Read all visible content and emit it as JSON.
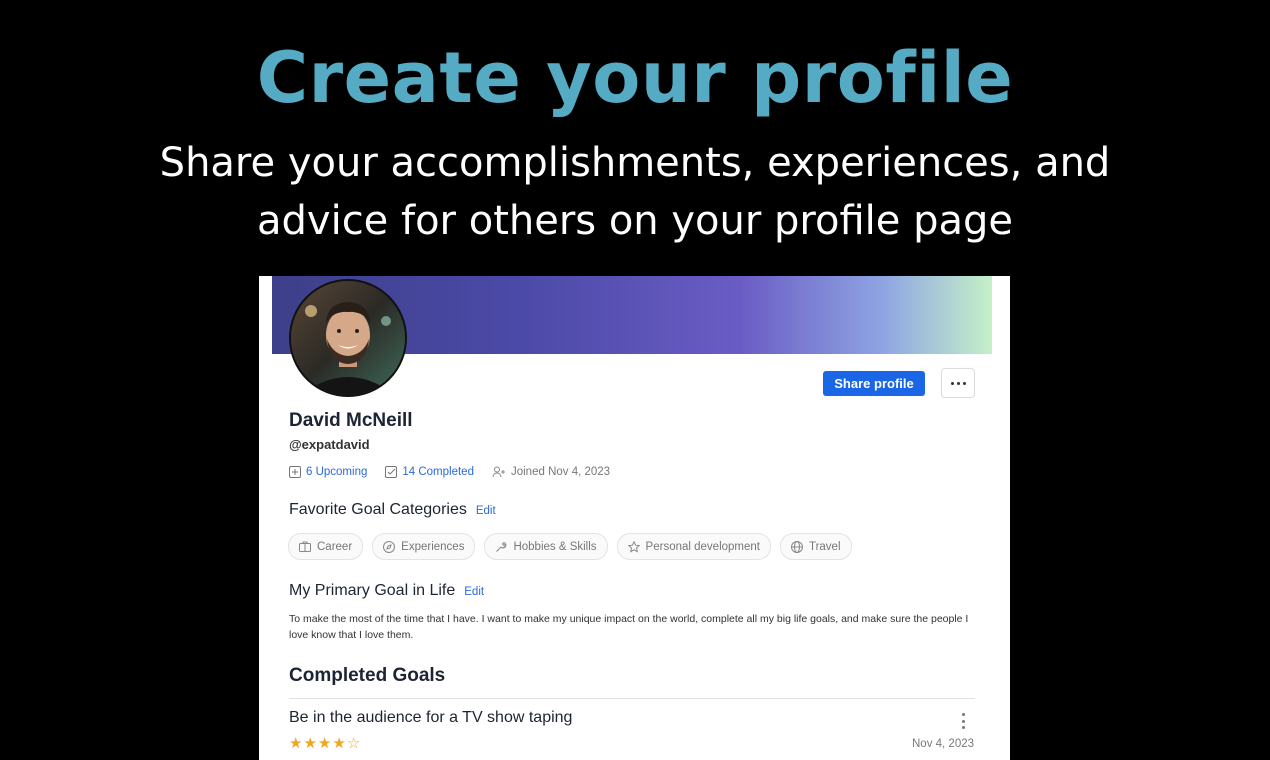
{
  "hero": {
    "title": "Create your profile",
    "subtitle_line1": "Share your accomplishments, experiences, and",
    "subtitle_line2": "advice for others on your profile page"
  },
  "profile": {
    "name": "David McNeill",
    "handle": "@expatdavid",
    "share_label": "Share profile",
    "stats": {
      "upcoming": "6 Upcoming",
      "completed": "14 Completed",
      "joined": "Joined Nov 4, 2023"
    },
    "favorite_section": {
      "heading": "Favorite Goal Categories",
      "edit": "Edit"
    },
    "categories": [
      {
        "label": "Career",
        "icon": "briefcase-icon"
      },
      {
        "label": "Experiences",
        "icon": "compass-icon"
      },
      {
        "label": "Hobbies & Skills",
        "icon": "wrench-icon"
      },
      {
        "label": "Personal development",
        "icon": "star-icon"
      },
      {
        "label": "Travel",
        "icon": "globe-icon"
      }
    ],
    "primary_goal": {
      "heading": "My Primary Goal in Life",
      "edit": "Edit",
      "text": "To make the most of the time that I have. I want to make my unique impact on the world, complete all my big life goals, and make sure the people I love know that I love them."
    },
    "completed_goals": {
      "heading": "Completed Goals",
      "items": [
        {
          "title": "Be in the audience for a TV show taping",
          "rating": 4,
          "rating_max": 5,
          "date": "Nov 4, 2023"
        }
      ]
    }
  },
  "colors": {
    "accent": "#1a66e6",
    "hero_title": "#55abc3",
    "star": "#f0a81a"
  }
}
